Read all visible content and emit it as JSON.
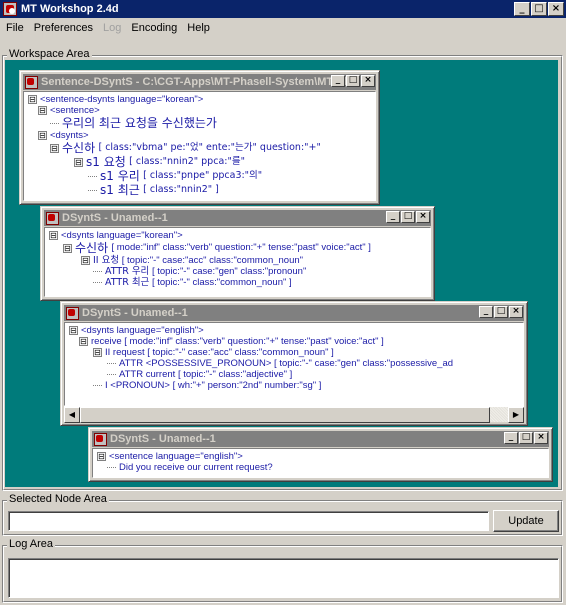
{
  "app": {
    "title": "MT Workshop 2.4d",
    "window_buttons": [
      "_",
      "□",
      "×"
    ]
  },
  "menu": [
    {
      "label": "File",
      "enabled": true
    },
    {
      "label": "Preferences",
      "enabled": true
    },
    {
      "label": "Log",
      "enabled": false
    },
    {
      "label": "Encoding",
      "enabled": true
    },
    {
      "label": "Help",
      "enabled": true
    }
  ],
  "workspace": {
    "label": "Workspace Area"
  },
  "frames": {
    "f1": {
      "title": "Sentence-DSyntS - C:\\CGT-Apps\\MT-Phasell-System\\MT-Pl",
      "rows": [
        {
          "toggle": "⊟",
          "text": "<sentence-dsynts language=\"korean\">"
        },
        {
          "toggle": "⊟",
          "text": "<sentence>"
        },
        {
          "text": "우리의 최근 요청을 수신했는가"
        },
        {
          "toggle": "⊟",
          "text": "<dsynts>"
        },
        {
          "toggle": "⊟",
          "word": "수신하",
          "attrs": "[ class:\"vbma\" pe:\"었\" ente:\"는가\" question:\"+\""
        },
        {
          "toggle": "⊟",
          "word": "s1 요청",
          "attrs": "[ class:\"nnin2\" ppca:\"를\""
        },
        {
          "word": "s1 우리",
          "attrs": "[ class:\"pnpe\" ppca3:\"의\""
        },
        {
          "word": "s1 최근",
          "attrs": "[ class:\"nnin2\" ]"
        }
      ]
    },
    "f2": {
      "title": "DSyntS - Unamed--1",
      "rows": [
        {
          "toggle": "⊟",
          "text": "<dsynts language=\"korean\">"
        },
        {
          "toggle": "⊟",
          "word": "수신하",
          "attrs": "[ mode:\"inf\" class:\"verb\" question:\"+\" tense:\"past\" voice:\"act\" ]"
        },
        {
          "toggle": "⊟",
          "word": "II 요청",
          "attrs": "[ topic:\"-\" case:\"acc\" class:\"common_noun\""
        },
        {
          "word": "ATTR 우리",
          "attrs": "[ topic:\"-\" case:\"gen\" class:\"pronoun\""
        },
        {
          "word": "ATTR 최근",
          "attrs": "[ topic:\"-\" class:\"common_noun\" ]"
        }
      ]
    },
    "f3": {
      "title": "DSyntS - Unamed--1",
      "rows": [
        {
          "toggle": "⊟",
          "text": "<dsynts language=\"english\">"
        },
        {
          "toggle": "⊟",
          "text": "receive [ mode:\"inf\" class:\"verb\" question:\"+\" tense:\"past\" voice:\"act\" ]"
        },
        {
          "toggle": "⊟",
          "text": "II request [ topic:\"-\" case:\"acc\" class:\"common_noun\" ]"
        },
        {
          "text": "ATTR <POSSESSIVE_PRONOUN> [ topic:\"-\" case:\"gen\" class:\"possessive_ad"
        },
        {
          "text": "ATTR current [ topic:\"-\" class:\"adjective\" ]"
        },
        {
          "text": "I <PRONOUN> [ wh:\"+\" person:\"2nd\" number:\"sg\" ]"
        }
      ]
    },
    "f4": {
      "title": "DSyntS - Unamed--1",
      "rows": [
        {
          "toggle": "⊟",
          "text": "<sentence language=\"english\">"
        },
        {
          "text": "Did you receive our current request?"
        }
      ]
    }
  },
  "selected_node": {
    "label": "Selected Node Area",
    "value": "",
    "button": "Update"
  },
  "log": {
    "label": "Log Area",
    "value": ""
  }
}
